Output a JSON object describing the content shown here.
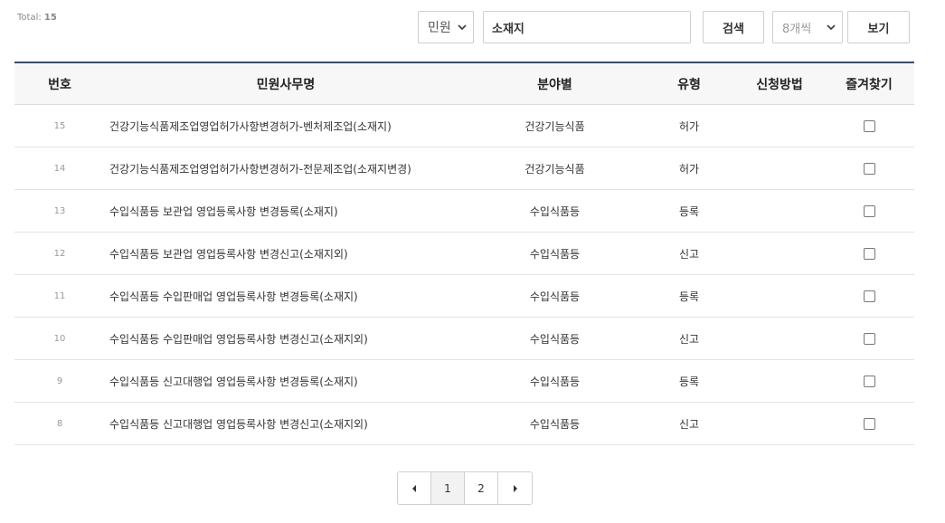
{
  "summary": {
    "total_label": "Total:",
    "total_count": "15"
  },
  "filters": {
    "category_value": "민원",
    "search_value": "소재지",
    "search_button": "검색",
    "page_size_value": "8개씩",
    "view_button": "보기"
  },
  "table": {
    "headers": {
      "no": "번호",
      "name": "민원사무명",
      "field": "분야별",
      "type": "유형",
      "method": "신청방법",
      "favorite": "즐겨찾기"
    },
    "rows": [
      {
        "no": "15",
        "name": "건강기능식품제조업영업허가사항변경허가-벤처제조업(소재지)",
        "field": "건강기능식품",
        "type": "허가",
        "method": "",
        "favorite": false
      },
      {
        "no": "14",
        "name": "건강기능식품제조업영업허가사항변경허가-전문제조업(소재지변경)",
        "field": "건강기능식품",
        "type": "허가",
        "method": "",
        "favorite": false
      },
      {
        "no": "13",
        "name": "수입식품등 보관업 영업등록사항 변경등록(소재지)",
        "field": "수입식품등",
        "type": "등록",
        "method": "",
        "favorite": false
      },
      {
        "no": "12",
        "name": "수입식품등 보관업 영업등록사항 변경신고(소재지외)",
        "field": "수입식품등",
        "type": "신고",
        "method": "",
        "favorite": false
      },
      {
        "no": "11",
        "name": "수입식품등 수입판매업 영업등록사항 변경등록(소재지)",
        "field": "수입식품등",
        "type": "등록",
        "method": "",
        "favorite": false
      },
      {
        "no": "10",
        "name": "수입식품등 수입판매업 영업등록사항 변경신고(소재지외)",
        "field": "수입식품등",
        "type": "신고",
        "method": "",
        "favorite": false
      },
      {
        "no": "9",
        "name": "수입식품등 신고대행업 영업등록사항 변경등록(소재지)",
        "field": "수입식품등",
        "type": "등록",
        "method": "",
        "favorite": false
      },
      {
        "no": "8",
        "name": "수입식품등 신고대행업 영업등록사항 변경신고(소재지외)",
        "field": "수입식품등",
        "type": "신고",
        "method": "",
        "favorite": false
      }
    ]
  },
  "pagination": {
    "prev_icon": "caret-left-icon",
    "next_icon": "caret-right-icon",
    "pages": [
      "1",
      "2"
    ],
    "current_page": "1"
  }
}
